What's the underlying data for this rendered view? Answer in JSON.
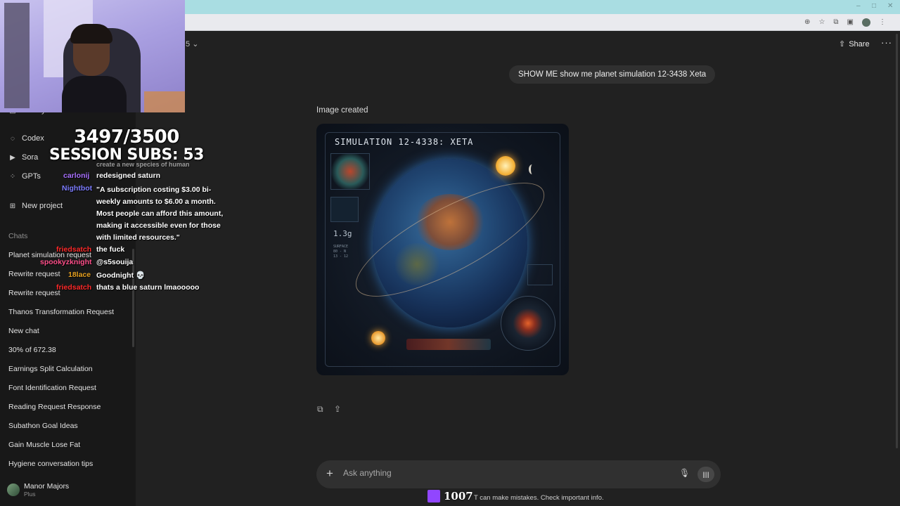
{
  "browser": {
    "win_controls": [
      "–",
      "□",
      "✕"
    ],
    "addr_icons": [
      "zoom-icon",
      "star-icon",
      "extensions-icon",
      "sidebar-icon",
      "profile-icon",
      "menu-icon"
    ]
  },
  "sidebar": {
    "library_label": "Library",
    "nav": [
      {
        "label": "Codex",
        "icon": "codex-icon"
      },
      {
        "label": "Sora",
        "icon": "sora-icon"
      },
      {
        "label": "GPTs",
        "icon": "gpts-icon"
      },
      {
        "label": "New project",
        "icon": "new-project-icon"
      }
    ],
    "chats_heading": "Chats",
    "chats": [
      "Planet simulation request",
      "Rewrite request",
      "Rewrite request",
      "Thanos Transformation Request",
      "New chat",
      "30% of 672.38",
      "Earnings Split Calculation",
      "Font Identification Request",
      "Reading Request Response",
      "Subathon Goal Ideas",
      "Gain Muscle Lose Fat",
      "Hygiene conversation tips"
    ],
    "user": {
      "name": "Manor Majors",
      "plan": "Plus"
    }
  },
  "overlay": {
    "subs_line1": "3497/3500",
    "subs_line2": "SESSION SUBS: 53",
    "chat": [
      {
        "user": "carlonij",
        "user_color": "#a970ff",
        "msg": "redesigned saturn"
      },
      {
        "user": "Nightbot",
        "user_color": "#7c7cff"
      },
      {
        "user": "friedsatch",
        "user_color": "#ff2a2a",
        "msg": "the fuck"
      },
      {
        "user": "spookyzknight",
        "user_color": "#ff4f8a",
        "msg": "@s5souija"
      },
      {
        "user": "18lace",
        "user_color": "#e6a020",
        "msg": "Goodnight 💀"
      },
      {
        "user": "friedsatch",
        "user_color": "#ff2a2a",
        "msg": "thats a blue saturn lmaooooo"
      }
    ],
    "nightbot_msg": "\"A subscription costing $3.00 bi-weekly amounts to $6.00 a month. Most people can afford this amount, making it accessible even for those with limited resources.\"",
    "partial_top": "create a new species of human",
    "viewers": "1007"
  },
  "header": {
    "model_fragment": "5",
    "share_label": "Share"
  },
  "conversation": {
    "user_message": "SHOW ME show me planet simulation 12-3438 Xeta",
    "image_status": "Image created",
    "image": {
      "title": "SIMULATION 12-4338: XETA",
      "readout": "1.3g",
      "small_lines": [
        "SURFACE",
        "80 - N",
        "13 - 12"
      ]
    }
  },
  "composer": {
    "placeholder": "Ask anything"
  },
  "footer": {
    "disclaimer_visible": "T can make mistakes. Check important info."
  },
  "colors": {
    "bg": "#212121",
    "sidebar": "#181818",
    "bubble": "#303030",
    "twitch": "#9146ff"
  }
}
